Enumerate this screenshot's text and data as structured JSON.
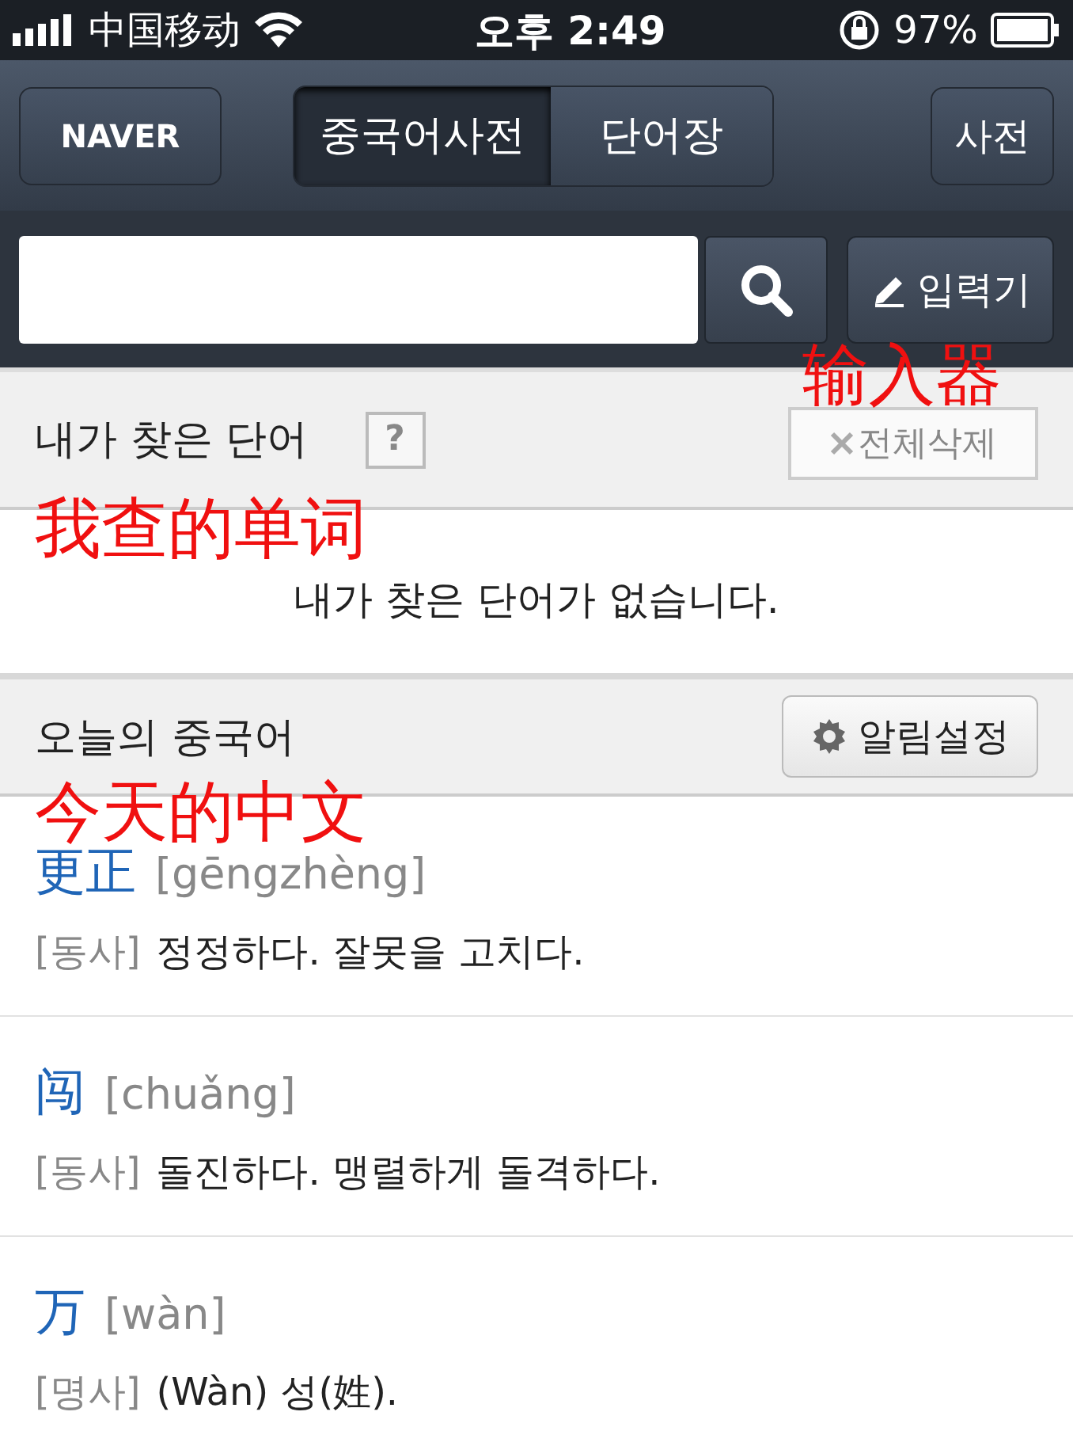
{
  "status_bar": {
    "carrier": "中国移动",
    "time": "오후 2:49",
    "battery": "97%"
  },
  "nav": {
    "logo": "NAVER",
    "tabs": [
      {
        "label": "중국어사전",
        "selected": true
      },
      {
        "label": "단어장",
        "selected": false
      }
    ],
    "right_button": "사전"
  },
  "search": {
    "input_button": "입력기",
    "annotation": "输入器"
  },
  "recent": {
    "title": "내가 찾은 단어",
    "help": "?",
    "clear_button": "전체삭제",
    "empty_message": "내가 찾은 단어가 없습니다.",
    "annotation": "我查的单词"
  },
  "today": {
    "title": "오늘의 중국어",
    "settings_button": "알림설정",
    "annotation": "今天的中文",
    "entries": [
      {
        "word": "更正",
        "pinyin": "[gēngzhèng]",
        "pos": "[동사]",
        "meaning": "정정하다. 잘못을 고치다."
      },
      {
        "word": "闯",
        "pinyin": "[chuǎng]",
        "pos": "[동사]",
        "meaning": "돌진하다. 맹렬하게 돌격하다."
      },
      {
        "word": "万",
        "pinyin": "[wàn]",
        "pos": "[명사]",
        "meaning": "(Wàn) 성(姓)."
      }
    ]
  }
}
